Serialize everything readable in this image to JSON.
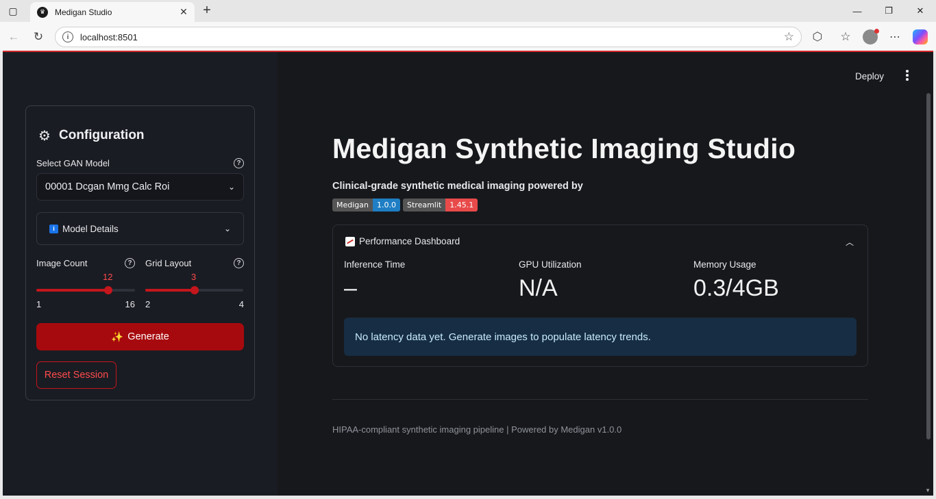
{
  "browser": {
    "tab_title": "Medigan Studio",
    "url": "localhost:8501"
  },
  "app": {
    "deploy_label": "Deploy",
    "sidebar": {
      "config_title": "Configuration",
      "model_label": "Select GAN Model",
      "model_value": "00001 Dcgan Mmg Calc Roi",
      "details_label": "Model Details",
      "image_count": {
        "label": "Image Count",
        "value": "12",
        "min": "1",
        "max": "16",
        "fraction": 0.733
      },
      "grid_layout": {
        "label": "Grid Layout",
        "value": "3",
        "min": "2",
        "max": "4",
        "fraction": 0.5
      },
      "generate_label": "Generate",
      "reset_label": "Reset Session"
    },
    "main": {
      "title": "Medigan Synthetic Imaging Studio",
      "subtitle": "Clinical-grade synthetic medical imaging powered by",
      "badges": [
        {
          "key": "Medigan",
          "value": "1.0.0",
          "color": "#1f7ec4"
        },
        {
          "key": "Streamlit",
          "value": "1.45.1",
          "color": "#e84a4a"
        }
      ],
      "dashboard": {
        "title": "Performance Dashboard",
        "metrics": [
          {
            "label": "Inference Time",
            "value": "–"
          },
          {
            "label": "GPU Utilization",
            "value": "N/A"
          },
          {
            "label": "Memory Usage",
            "value": "0.3/4GB"
          }
        ],
        "info": "No latency data yet. Generate images to populate latency trends."
      },
      "footer": "HIPAA-compliant synthetic imaging pipeline | Powered by Medigan v1.0.0"
    }
  },
  "colors": {
    "accent": "#a70a0e",
    "slider": "#c4161c",
    "info_bg": "#172d43"
  }
}
